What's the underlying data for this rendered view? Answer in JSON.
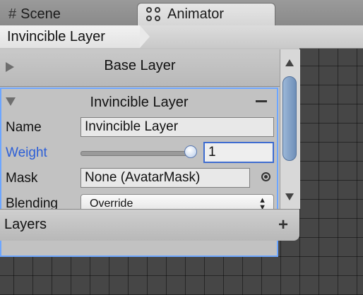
{
  "tabs": [
    {
      "label": "Scene",
      "icon": "grid-icon"
    },
    {
      "label": "Animator",
      "icon": "animator-icon"
    }
  ],
  "breadcrumb": {
    "label": "Invincible Layer"
  },
  "layers_panel": {
    "base_layer": {
      "label": "Base Layer"
    },
    "selected_layer": {
      "title": "Invincible Layer",
      "name_label": "Name",
      "name_value": "Invincible Layer",
      "weight_label": "Weight",
      "weight_value": "1",
      "weight_slider_fraction": 1.0,
      "mask_label": "Mask",
      "mask_value": "None (AvatarMask)",
      "blending_label": "Blending",
      "blending_value": "Override"
    },
    "footer_label": "Layers",
    "add_symbol": "+",
    "remove_symbol": "−"
  },
  "colors": {
    "active_label": "#2d5fd6",
    "selection_outline": "#6da6ff",
    "panel_bg": "#c4c4c4",
    "graph_bg": "#464646"
  }
}
